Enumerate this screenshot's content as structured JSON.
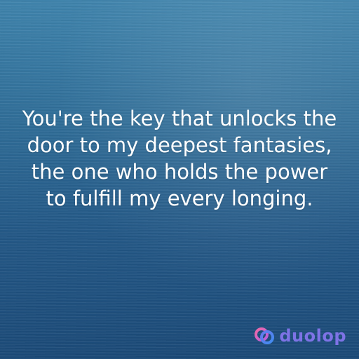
{
  "quote": {
    "text": "You're the key that unlocks the door to my deepest fantasies, the one who holds the power to fulfill my every longing."
  },
  "brand": {
    "name": "duolop",
    "icon": "duolop-logo-icon",
    "colors": {
      "text": "#7e73e6",
      "ring_left": "#e25fb1",
      "ring_right": "#5a7ff0"
    }
  },
  "background": {
    "colors": [
      "#3f84ad",
      "#235887",
      "#1b4a78"
    ]
  }
}
